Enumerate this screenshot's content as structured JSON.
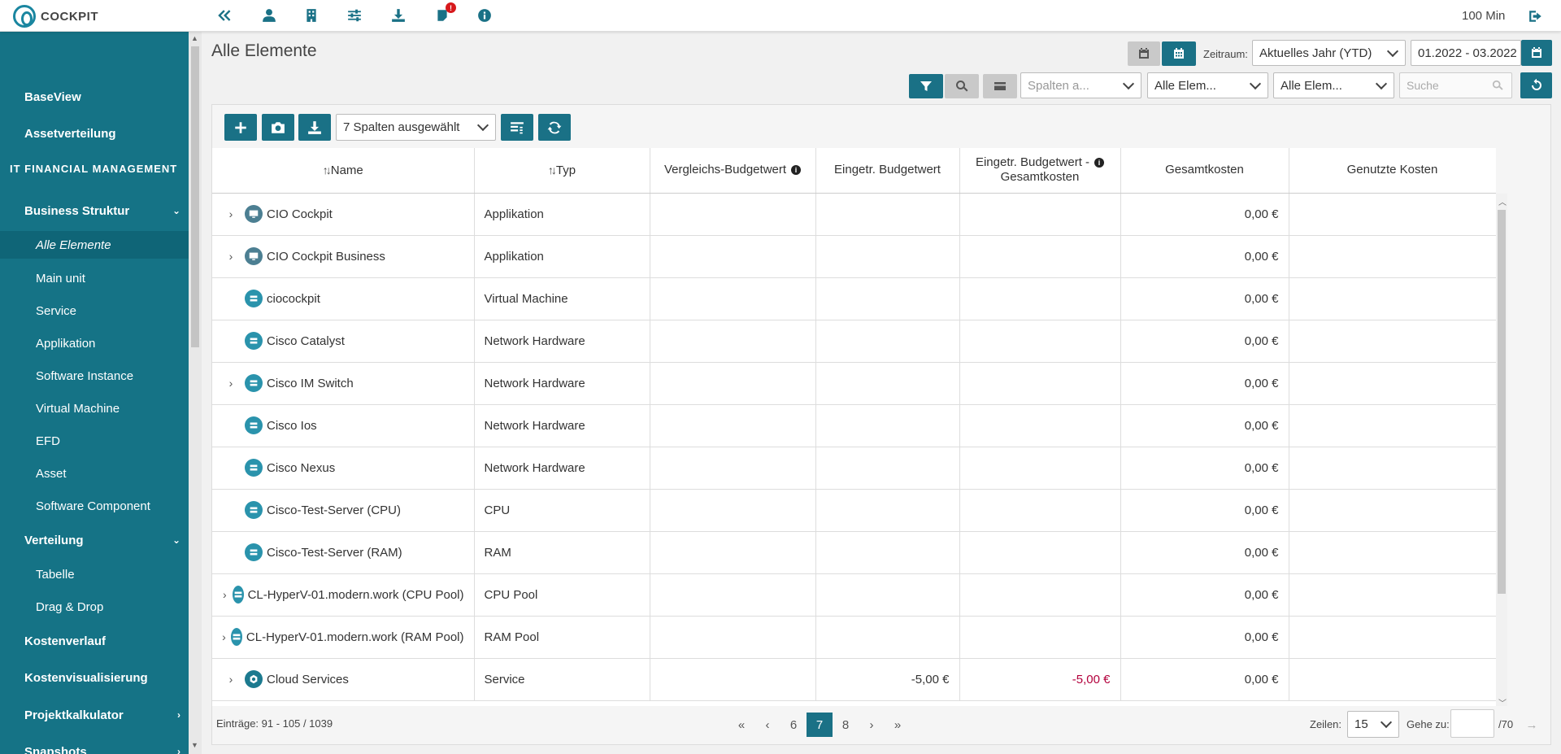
{
  "app": {
    "title": "COCKPIT",
    "session": "100 Min"
  },
  "sidebar": {
    "items": [
      {
        "label": "BaseView"
      },
      {
        "label": "Assetverteilung"
      },
      {
        "label": "IT FINANCIAL MANAGEMENT"
      },
      {
        "label": "Business Struktur"
      },
      {
        "label": "Alle Elemente"
      },
      {
        "label": "Main unit"
      },
      {
        "label": "Service"
      },
      {
        "label": "Applikation"
      },
      {
        "label": "Software Instance"
      },
      {
        "label": "Virtual Machine"
      },
      {
        "label": "EFD"
      },
      {
        "label": "Asset"
      },
      {
        "label": "Software Component"
      },
      {
        "label": "Verteilung"
      },
      {
        "label": "Tabelle"
      },
      {
        "label": "Drag & Drop"
      },
      {
        "label": "Kostenverlauf"
      },
      {
        "label": "Kostenvisualisierung"
      },
      {
        "label": "Projektkalkulator"
      },
      {
        "label": "Snapshots"
      }
    ]
  },
  "header": {
    "title": "Alle Elemente",
    "zeitraum_label": "Zeitraum:",
    "zeitraum_value": "Aktuelles Jahr (YTD)",
    "date_range": "01.2022 - 03.2022",
    "filters": {
      "columns_placeholder": "Spalten a...",
      "filter2": "Alle Elem...",
      "filter3": "Alle Elem...",
      "search_placeholder": "Suche"
    }
  },
  "toolbar": {
    "columns_selected": "7 Spalten ausgewählt"
  },
  "table": {
    "columns": {
      "name": "Name",
      "typ": "Typ",
      "vergleich": "Vergleichs-Budgetwert",
      "budget": "Eingetr. Budgetwert",
      "budget_minus_1": "Eingetr. Budgetwert -",
      "budget_minus_2": "Gesamtkosten",
      "gesamt": "Gesamtkosten",
      "genutzt": "Genutzte Kosten"
    },
    "rows": [
      {
        "name": "CIO Cockpit",
        "typ": "Applikation",
        "vergleich": "",
        "budget": "",
        "diff": "",
        "gesamt": "0,00 €",
        "genutzt": ""
      },
      {
        "name": "CIO Cockpit Business",
        "typ": "Applikation",
        "vergleich": "",
        "budget": "",
        "diff": "",
        "gesamt": "0,00 €",
        "genutzt": ""
      },
      {
        "name": "ciocockpit",
        "typ": "Virtual Machine",
        "vergleich": "",
        "budget": "",
        "diff": "",
        "gesamt": "0,00 €",
        "genutzt": ""
      },
      {
        "name": "Cisco Catalyst",
        "typ": "Network Hardware",
        "vergleich": "",
        "budget": "",
        "diff": "",
        "gesamt": "0,00 €",
        "genutzt": ""
      },
      {
        "name": "Cisco IM Switch",
        "typ": "Network Hardware",
        "vergleich": "",
        "budget": "",
        "diff": "",
        "gesamt": "0,00 €",
        "genutzt": ""
      },
      {
        "name": "Cisco Ios",
        "typ": "Network Hardware",
        "vergleich": "",
        "budget": "",
        "diff": "",
        "gesamt": "0,00 €",
        "genutzt": ""
      },
      {
        "name": "Cisco Nexus",
        "typ": "Network Hardware",
        "vergleich": "",
        "budget": "",
        "diff": "",
        "gesamt": "0,00 €",
        "genutzt": ""
      },
      {
        "name": "Cisco-Test-Server (CPU)",
        "typ": "CPU",
        "vergleich": "",
        "budget": "",
        "diff": "",
        "gesamt": "0,00 €",
        "genutzt": ""
      },
      {
        "name": "Cisco-Test-Server (RAM)",
        "typ": "RAM",
        "vergleich": "",
        "budget": "",
        "diff": "",
        "gesamt": "0,00 €",
        "genutzt": ""
      },
      {
        "name": "CL-HyperV-01.modern.work (CPU Pool)",
        "typ": "CPU Pool",
        "vergleich": "",
        "budget": "",
        "diff": "",
        "gesamt": "0,00 €",
        "genutzt": ""
      },
      {
        "name": "CL-HyperV-01.modern.work (RAM Pool)",
        "typ": "RAM Pool",
        "vergleich": "",
        "budget": "",
        "diff": "",
        "gesamt": "0,00 €",
        "genutzt": ""
      },
      {
        "name": "Cloud Services",
        "typ": "Service",
        "vergleich": "",
        "budget": "-5,00 €",
        "diff": "-5,00 €",
        "gesamt": "0,00 €",
        "genutzt": ""
      }
    ]
  },
  "footer": {
    "entries": "Einträge: 91 - 105 / 1039",
    "pages": [
      "6",
      "7",
      "8"
    ],
    "current_page": "7",
    "rows_label": "Zeilen:",
    "rows_value": "15",
    "goto_label": "Gehe zu:",
    "goto_total": "/70"
  },
  "colors": {
    "accent": "#1a7186",
    "sidebar": "#157386",
    "negative": "#b3003c",
    "badge": "#d7191c"
  },
  "icons": [
    "collapse-icon",
    "user-icon",
    "building-icon",
    "sliders-icon",
    "download-icon",
    "notification-icon",
    "info-icon",
    "logout-icon"
  ],
  "notification_count": "!"
}
